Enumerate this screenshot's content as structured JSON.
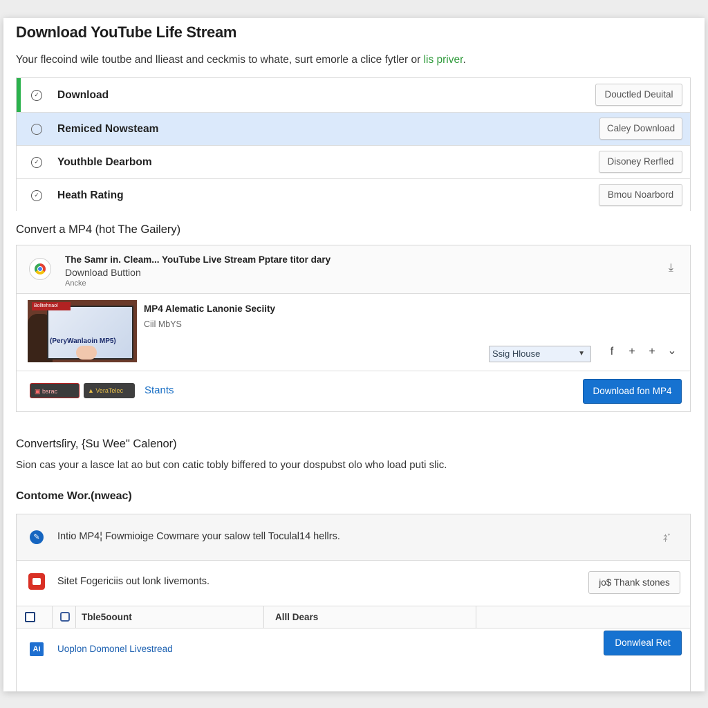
{
  "header": {
    "title": "Download YouTube Life Stream",
    "subtitle_prefix": "Your flecoind wile toutbe and llieast and ceckmis to whate, surt emorle a clice fytler or ",
    "subtitle_link": "lis priver",
    "subtitle_suffix": "."
  },
  "list": {
    "items": [
      {
        "label": "Download",
        "button": "Douctled Deuital",
        "icon": "check-circle-icon"
      },
      {
        "label": "Remiced Nowsteam",
        "button": "Caley Download",
        "icon": "radio-circle-icon"
      },
      {
        "label": "Youthble Dearbom",
        "button": "Disoney Rerfled",
        "icon": "check-circle-icon"
      },
      {
        "label": "Heath Rating",
        "button": "Bmou Noarbord",
        "icon": "check-circle-icon"
      }
    ]
  },
  "convert": {
    "heading": "Convert a MP4 (hot The Gailery)",
    "source_title": "The Samr in. Cleam... YouTube Live Stream Pptare titor dary",
    "source_sub": "Download Buttion",
    "source_small": "Ancke",
    "media_title": "MP4 Alematic Lanonie Seciity",
    "media_sub": "Ciil MbYS",
    "thumb_label": "(PeryWanlaoin MP5)",
    "thumb_tag": "Bolltehnaol",
    "select_value": "Ssig Hlouse",
    "badges": [
      "bsrac",
      "VeraTelec"
    ],
    "stants_label": "Stants",
    "download_button": "Download fon MP4",
    "mini_icons": [
      "f",
      "+",
      "+",
      "⌄"
    ]
  },
  "converts_section": {
    "heading": "Convertsſiry, {Su Wee\" Calenor)",
    "paragraph": "Sion cas your a lasce lat ao but con catic tobly biffered to your dospubst olo who load puti slic."
  },
  "contome": {
    "heading": "Contome Wor.(nweac)",
    "row1_text": "Intio MP4¦ Fowmioige Cowmare your salow tell Toculal14 hellrs.",
    "row1_right": "ﾈﾞ",
    "row2_text": "Sitet Fogericiis out lonk Iivemonts.",
    "row2_button": "jo$ Thank stones",
    "table_headers": [
      "",
      "",
      "Tble5oount",
      "Alll Dears",
      ""
    ],
    "last_row_text": "Uoplon Domonel Livestread",
    "last_row_button": "Donwleal Ret",
    "last_icon": "Ai"
  },
  "colors": {
    "accent_green": "#2bb24c",
    "selected_row": "#dbe9fb",
    "primary_blue": "#1672d0",
    "link_blue": "#1a6fc4",
    "youtube_red": "#d93025"
  }
}
